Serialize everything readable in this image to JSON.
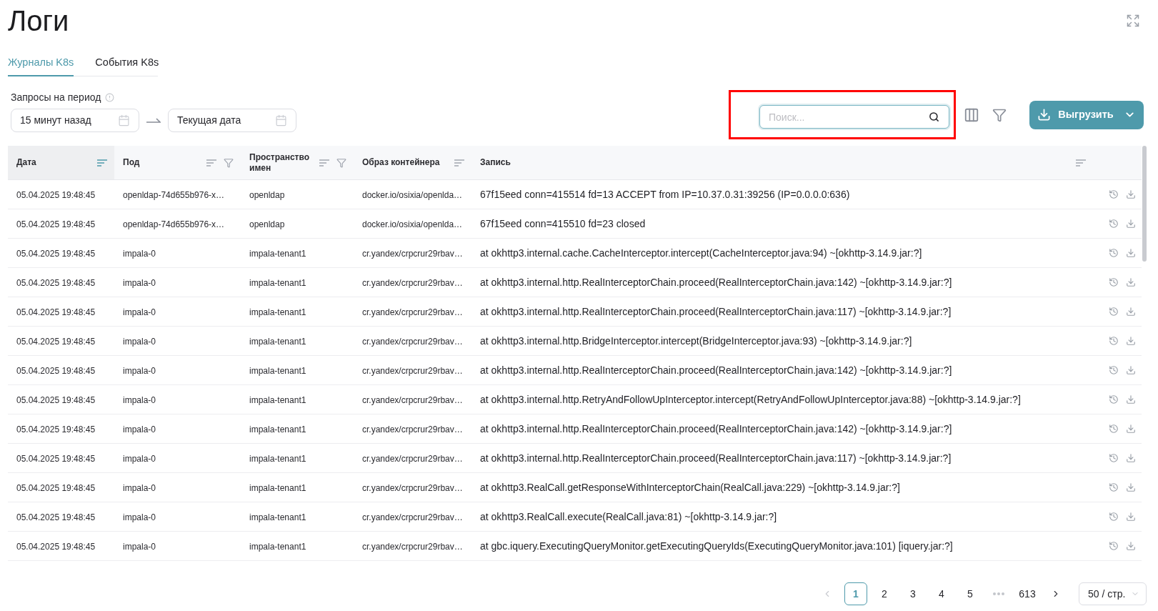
{
  "page": {
    "title": "Логи"
  },
  "tabs": [
    {
      "label": "Журналы K8s",
      "selected": true
    },
    {
      "label": "События K8s",
      "selected": false
    }
  ],
  "period": {
    "label": "Запросы на период",
    "from": "15 минут назад",
    "to": "Текущая дата"
  },
  "toolbar": {
    "search": {
      "placeholder": "Поиск...",
      "highlighted": true
    },
    "export_button": "Выгрузить"
  },
  "table": {
    "columns": [
      {
        "label": "Дата",
        "sorted": true,
        "filterable": false
      },
      {
        "label": "Под",
        "sorted": false,
        "filterable": true
      },
      {
        "label": "Пространство имен",
        "sorted": false,
        "filterable": true
      },
      {
        "label": "Образ контейнера",
        "sorted": false,
        "filterable": false
      },
      {
        "label": "Запись",
        "sorted": false,
        "filterable": false
      }
    ],
    "rows": [
      {
        "date": "05.04.2025 19:48:45",
        "pod": "openldap-74d655b976-x…",
        "namespace": "openldap",
        "image": "docker.io/osixia/openlda…",
        "record": "67f15eed conn=415514 fd=13 ACCEPT from IP=10.37.0.31:39256 (IP=0.0.0.0:636)"
      },
      {
        "date": "05.04.2025 19:48:45",
        "pod": "openldap-74d655b976-x…",
        "namespace": "openldap",
        "image": "docker.io/osixia/openlda…",
        "record": "67f15eed conn=415510 fd=23 closed"
      },
      {
        "date": "05.04.2025 19:48:45",
        "pod": "impala-0",
        "namespace": "impala-tenant1",
        "image": "cr.yandex/crpcrur29rbav…",
        "record": "at okhttp3.internal.cache.CacheInterceptor.intercept(CacheInterceptor.java:94) ~[okhttp-3.14.9.jar:?]"
      },
      {
        "date": "05.04.2025 19:48:45",
        "pod": "impala-0",
        "namespace": "impala-tenant1",
        "image": "cr.yandex/crpcrur29rbav…",
        "record": "at okhttp3.internal.http.RealInterceptorChain.proceed(RealInterceptorChain.java:142) ~[okhttp-3.14.9.jar:?]"
      },
      {
        "date": "05.04.2025 19:48:45",
        "pod": "impala-0",
        "namespace": "impala-tenant1",
        "image": "cr.yandex/crpcrur29rbav…",
        "record": "at okhttp3.internal.http.RealInterceptorChain.proceed(RealInterceptorChain.java:117) ~[okhttp-3.14.9.jar:?]"
      },
      {
        "date": "05.04.2025 19:48:45",
        "pod": "impala-0",
        "namespace": "impala-tenant1",
        "image": "cr.yandex/crpcrur29rbav…",
        "record": "at okhttp3.internal.http.BridgeInterceptor.intercept(BridgeInterceptor.java:93) ~[okhttp-3.14.9.jar:?]"
      },
      {
        "date": "05.04.2025 19:48:45",
        "pod": "impala-0",
        "namespace": "impala-tenant1",
        "image": "cr.yandex/crpcrur29rbav…",
        "record": "at okhttp3.internal.http.RealInterceptorChain.proceed(RealInterceptorChain.java:142) ~[okhttp-3.14.9.jar:?]"
      },
      {
        "date": "05.04.2025 19:48:45",
        "pod": "impala-0",
        "namespace": "impala-tenant1",
        "image": "cr.yandex/crpcrur29rbav…",
        "record": "at okhttp3.internal.http.RetryAndFollowUpInterceptor.intercept(RetryAndFollowUpInterceptor.java:88) ~[okhttp-3.14.9.jar:?]"
      },
      {
        "date": "05.04.2025 19:48:45",
        "pod": "impala-0",
        "namespace": "impala-tenant1",
        "image": "cr.yandex/crpcrur29rbav…",
        "record": "at okhttp3.internal.http.RealInterceptorChain.proceed(RealInterceptorChain.java:142) ~[okhttp-3.14.9.jar:?]"
      },
      {
        "date": "05.04.2025 19:48:45",
        "pod": "impala-0",
        "namespace": "impala-tenant1",
        "image": "cr.yandex/crpcrur29rbav…",
        "record": "at okhttp3.internal.http.RealInterceptorChain.proceed(RealInterceptorChain.java:117) ~[okhttp-3.14.9.jar:?]"
      },
      {
        "date": "05.04.2025 19:48:45",
        "pod": "impala-0",
        "namespace": "impala-tenant1",
        "image": "cr.yandex/crpcrur29rbav…",
        "record": "at okhttp3.RealCall.getResponseWithInterceptorChain(RealCall.java:229) ~[okhttp-3.14.9.jar:?]"
      },
      {
        "date": "05.04.2025 19:48:45",
        "pod": "impala-0",
        "namespace": "impala-tenant1",
        "image": "cr.yandex/crpcrur29rbav…",
        "record": "at okhttp3.RealCall.execute(RealCall.java:81) ~[okhttp-3.14.9.jar:?]"
      },
      {
        "date": "05.04.2025 19:48:45",
        "pod": "impala-0",
        "namespace": "impala-tenant1",
        "image": "cr.yandex/crpcrur29rbav…",
        "record": "at gbc.iquery.ExecutingQueryMonitor.getExecutingQueryIds(ExecutingQueryMonitor.java:101) [iquery.jar:?]"
      }
    ]
  },
  "pagination": {
    "previous_disabled": true,
    "items": [
      {
        "kind": "page",
        "label": "1",
        "selected": true
      },
      {
        "kind": "page",
        "label": "2",
        "selected": false
      },
      {
        "kind": "page",
        "label": "3",
        "selected": false
      },
      {
        "kind": "page",
        "label": "4",
        "selected": false
      },
      {
        "kind": "page",
        "label": "5",
        "selected": false
      },
      {
        "kind": "ellipsis",
        "selected": false
      },
      {
        "kind": "page",
        "label": "613",
        "selected": false
      }
    ],
    "next_disabled": false,
    "page_size": "50 / стр."
  }
}
